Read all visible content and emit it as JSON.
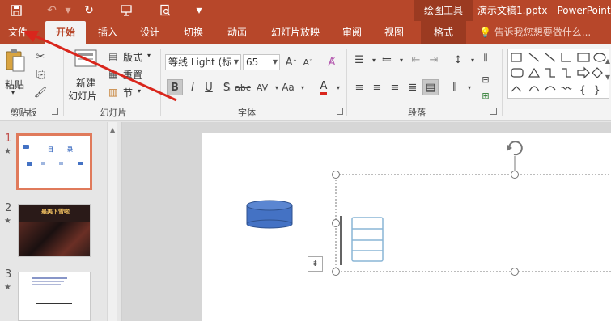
{
  "titlebar": {
    "drawing_tools": "绘图工具",
    "window_title": "演示文稿1.pptx - PowerPoint("
  },
  "tabs": {
    "file": "文件",
    "home": "开始",
    "insert": "插入",
    "design": "设计",
    "transitions": "切换",
    "animations": "动画",
    "slideshow": "幻灯片放映",
    "review": "审阅",
    "view": "视图",
    "format": "格式",
    "tell_me": "告诉我您想要做什么..."
  },
  "ribbon": {
    "clipboard": {
      "paste": "粘贴",
      "label": "剪贴板"
    },
    "slides": {
      "new_slide_line1": "新建",
      "new_slide_line2": "幻灯片",
      "layout": "版式",
      "reset": "重置",
      "section": "节",
      "label": "幻灯片"
    },
    "font": {
      "font_name": "等线 Light (标",
      "font_size": "65",
      "label": "字体"
    },
    "paragraph": {
      "label": "段落"
    }
  },
  "slides": [
    {
      "number": "1",
      "title": "目",
      "title2": "录"
    },
    {
      "number": "2",
      "title": "最美下雪啦"
    },
    {
      "number": "3"
    }
  ],
  "colors": {
    "accent": "#b7472a",
    "accent_dark": "#9b3a21",
    "selection": "#e07a5b",
    "arrow": "#d9261c",
    "cylinder_fill": "#4472c4"
  }
}
